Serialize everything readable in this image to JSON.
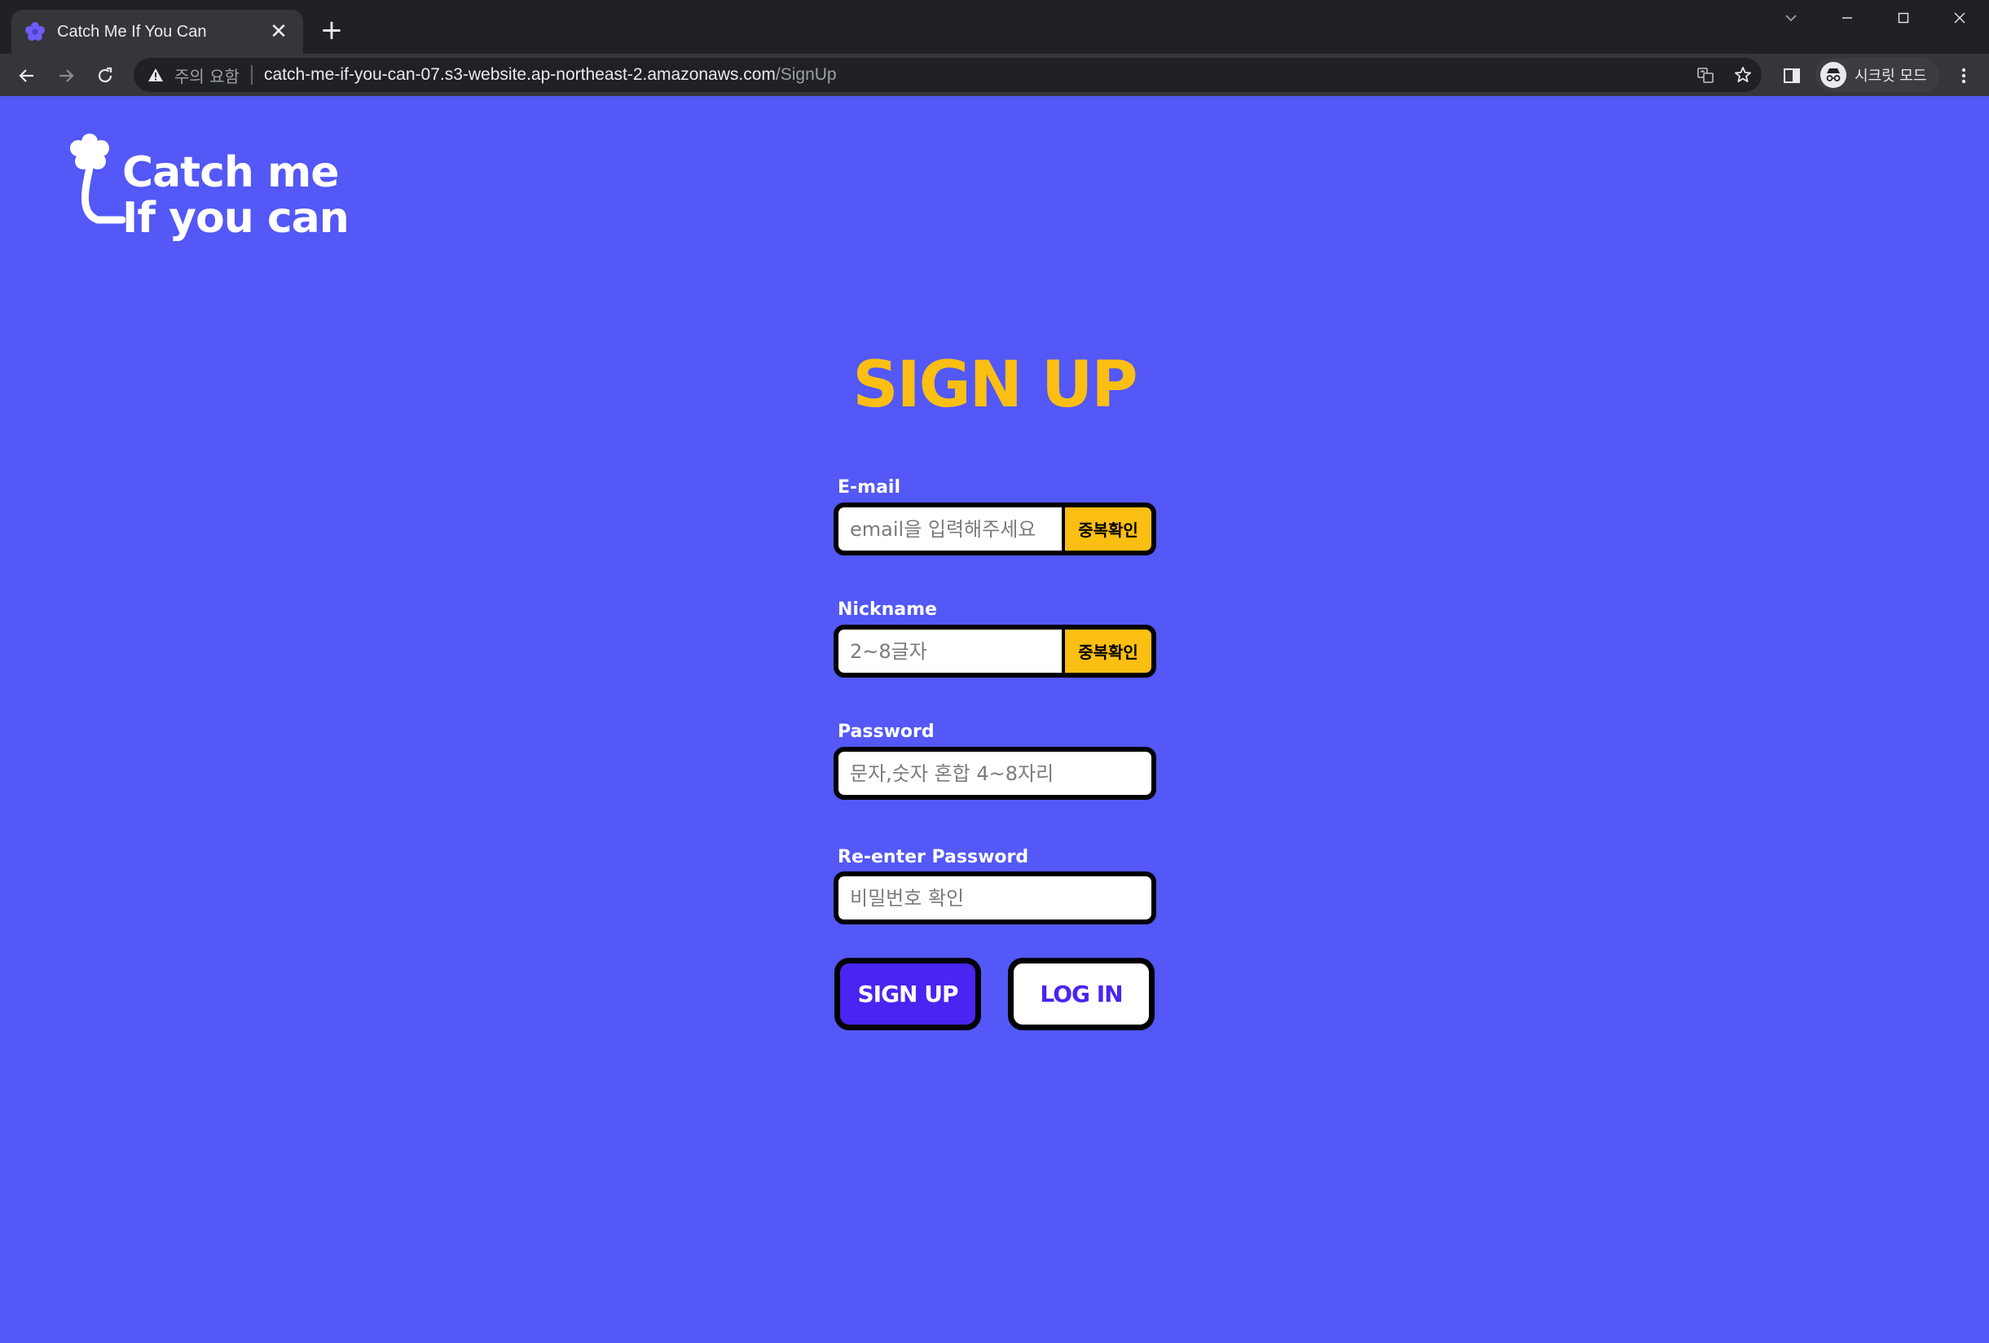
{
  "browser": {
    "tab_title": "Catch Me If You Can",
    "tab_close": "✕",
    "new_tab": "+",
    "security_label": "주의 요함",
    "url_host": "catch-me-if-you-can-07.s3-website.ap-northeast-2.amazonaws.com",
    "url_path": "/SignUp",
    "incognito_label": "시크릿 모드"
  },
  "logo": {
    "line1": "Catch me",
    "line2": "If you can"
  },
  "form": {
    "heading": "SIGN UP",
    "email": {
      "label": "E-mail",
      "placeholder": "email을 입력해주세요",
      "value": "",
      "check_button": "중복확인"
    },
    "nickname": {
      "label": "Nickname",
      "placeholder": "2~8글자",
      "value": "",
      "check_button": "중복확인"
    },
    "password": {
      "label": "Password",
      "placeholder": "문자,숫자 혼합 4~8자리",
      "value": ""
    },
    "password_confirm": {
      "label": "Re-enter Password",
      "placeholder": "비밀번호 확인",
      "value": ""
    },
    "signup_button": "SIGN UP",
    "login_button": "LOG IN"
  },
  "colors": {
    "background": "#5358f6",
    "heading": "#fbbf13",
    "check_button": "#fbbf13",
    "signup_button": "#4a24f0",
    "login_text": "#4a24f0",
    "border": "#000000"
  },
  "icons": {
    "favicon": "flower-icon",
    "back": "arrow-left-icon",
    "forward": "arrow-right-icon",
    "reload": "reload-icon",
    "warning": "warning-triangle-icon",
    "translate": "translate-icon",
    "bookmark": "star-icon",
    "side_panel": "side-panel-icon",
    "incognito": "incognito-icon",
    "menu": "kebab-menu-icon",
    "tab_search": "chevron-down-icon",
    "minimize": "minimize-icon",
    "maximize": "maximize-icon",
    "close_window": "close-icon"
  }
}
